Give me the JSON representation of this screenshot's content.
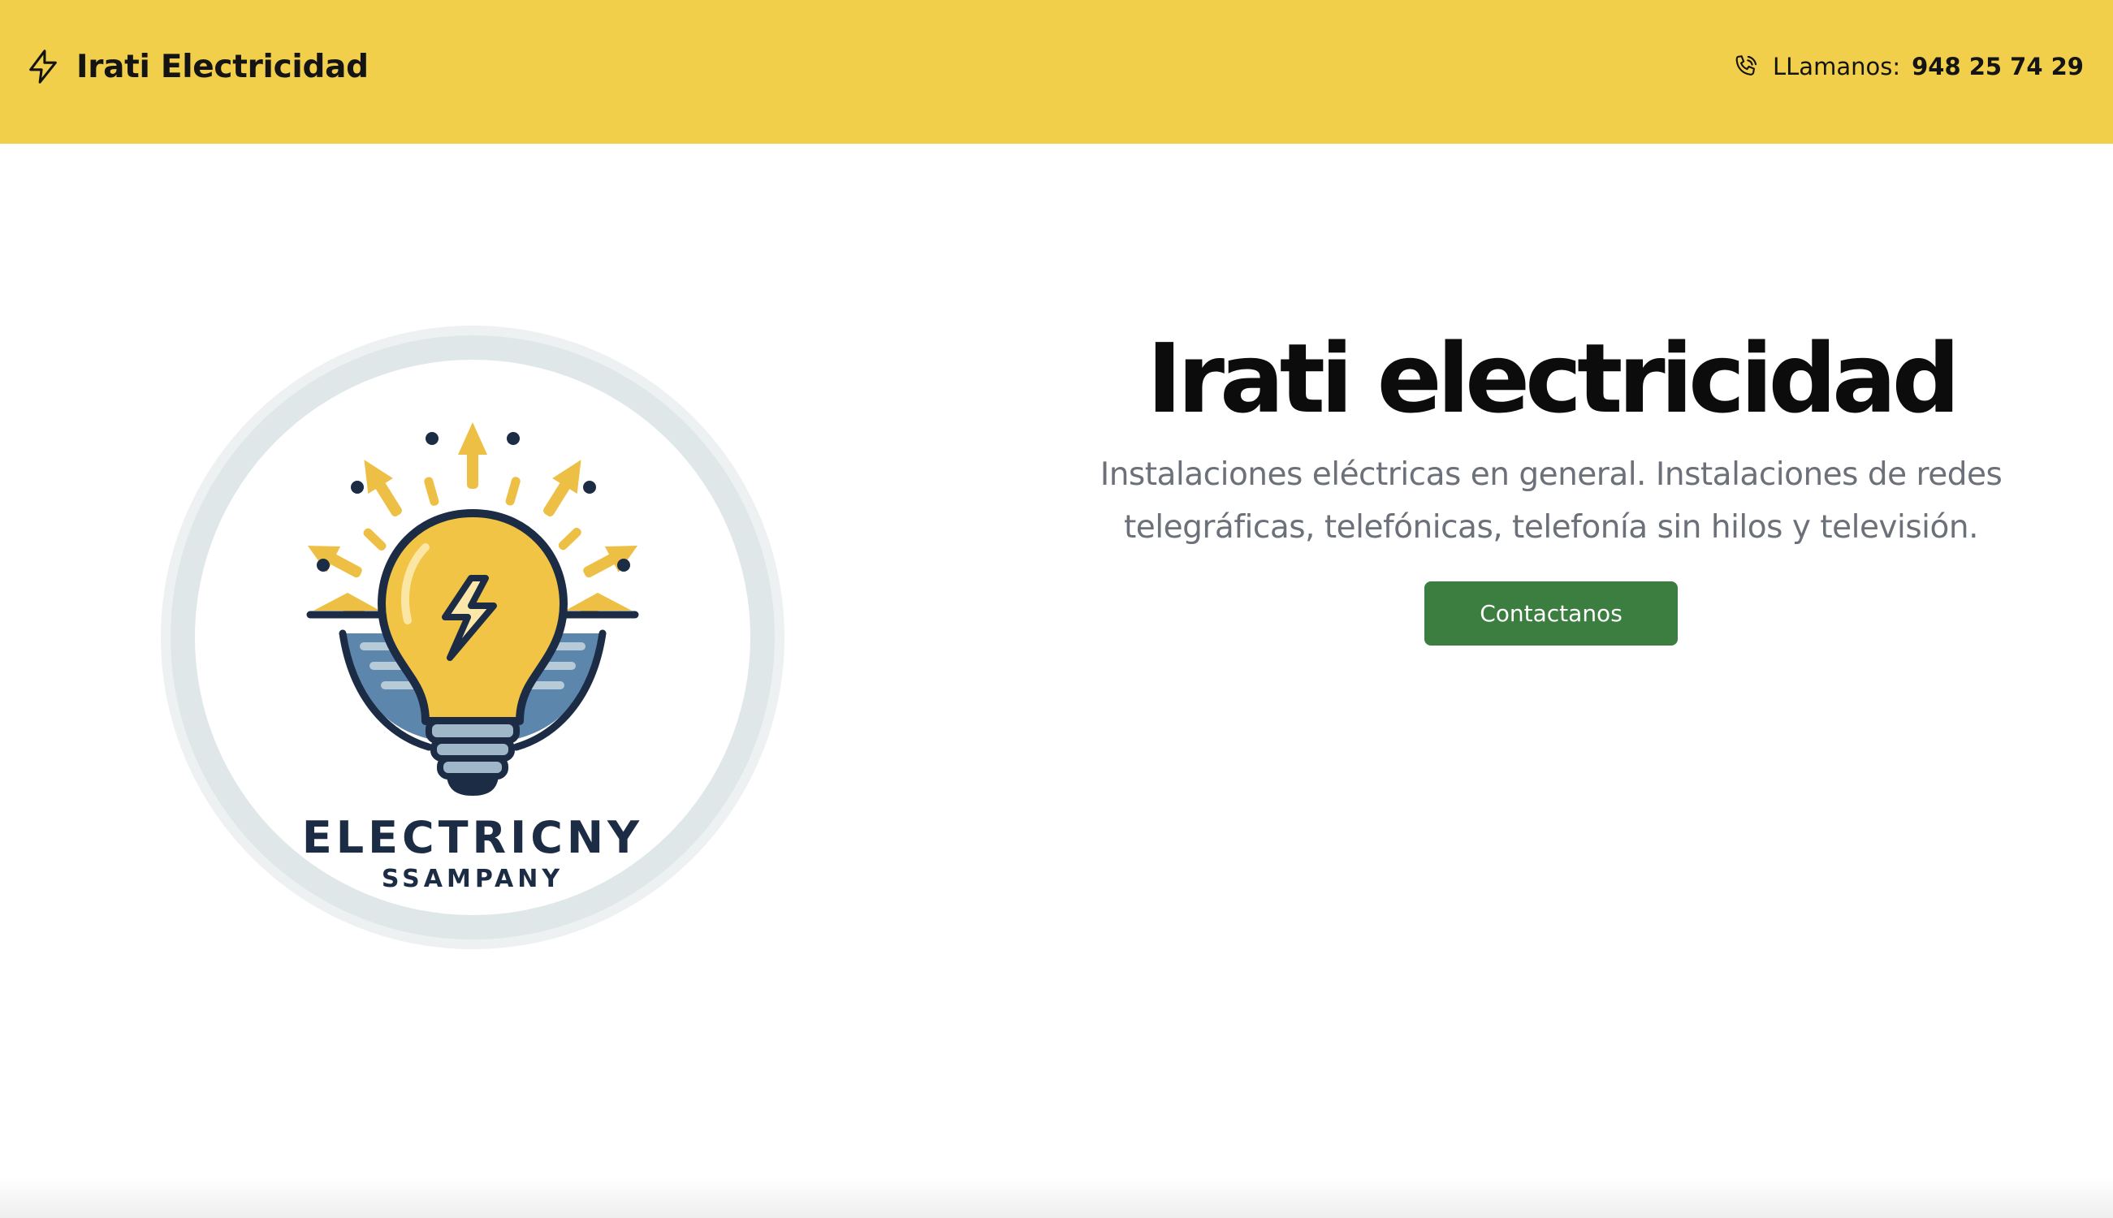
{
  "header": {
    "brand_name": "Irati Electricidad",
    "brand_icon": "lightning-bolt-icon",
    "call_icon": "phone-icon",
    "call_label": "LLamanos:",
    "call_number": "948 25 74 29",
    "background_color": "#f2cf4b"
  },
  "hero": {
    "logo": {
      "alt": "Logo bombilla",
      "wordmark_line1": "ELECTRICNY",
      "wordmark_line2": "SSAMPANY"
    },
    "title": "Irati electricidad",
    "description": "Instalaciones eléctricas en general. Instalaciones de redes telegráficas, telefónicas, telefonía sin hilos y televisión.",
    "cta_label": "Contactanos",
    "cta_color": "#3c7d40"
  }
}
